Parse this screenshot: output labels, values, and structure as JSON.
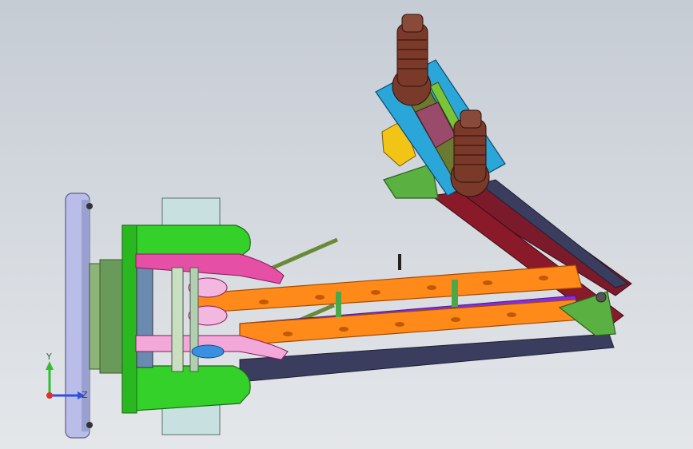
{
  "triad": {
    "y_label": "Y",
    "z_label": "Z",
    "y_color": "#2fbf2f",
    "z_color": "#3050e0",
    "x_color": "#e03030"
  },
  "colors": {
    "background_top": "#c6ccd4",
    "background_bottom": "#e4e7ea",
    "base_plate": "#b9bde8",
    "green_part": "#34d12a",
    "orange_link": "#ff8a1a",
    "purple_link": "#8a2be2",
    "dark_link": "#3a3d5e",
    "maroon_link": "#8a1a2a",
    "cyan_plate": "#2aa6d8",
    "pink_part": "#e64fa6",
    "brown_finger": "#7a3a2a",
    "yellow_part": "#f2c416",
    "grey_block": "#c8e0e0"
  }
}
